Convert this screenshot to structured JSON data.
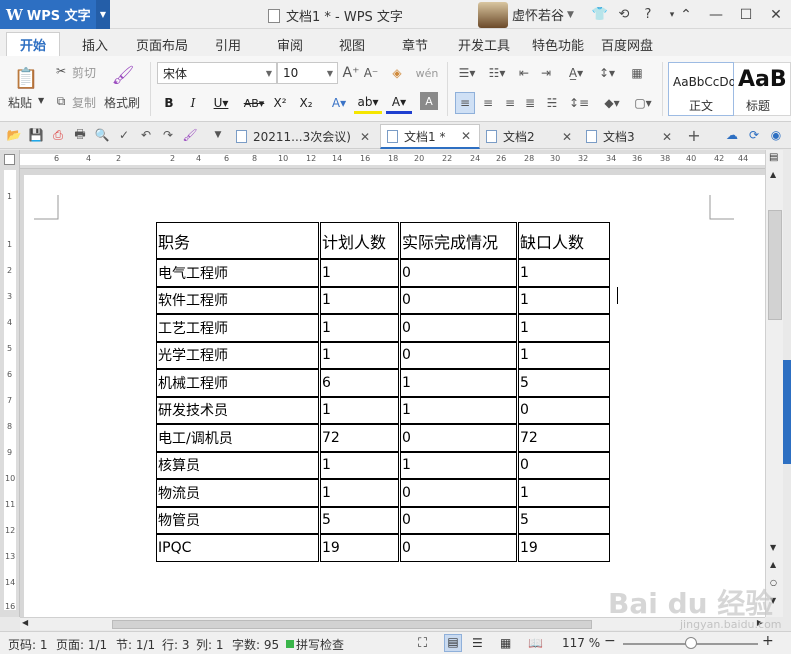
{
  "app": {
    "name": "WPS 文字",
    "window_title": "文档1 * - WPS 文字",
    "user_name": "虚怀若谷"
  },
  "menu_tabs": [
    "开始",
    "插入",
    "页面布局",
    "引用",
    "审阅",
    "视图",
    "章节",
    "开发工具",
    "特色功能",
    "百度网盘"
  ],
  "ribbon": {
    "paste": "粘贴",
    "cut": "剪切",
    "copy": "复制",
    "format_painter": "格式刷",
    "font_name": "宋体",
    "font_size": "10",
    "style_normal_preview": "AaBbCcDd",
    "style_normal_label": "正文",
    "style_heading_preview": "AaB",
    "style_heading_label": "标题"
  },
  "doc_tabs": [
    {
      "label": "20211...3次会议)"
    },
    {
      "label": "文档1 *"
    },
    {
      "label": "文档2"
    },
    {
      "label": "文档3"
    }
  ],
  "ruler": {
    "h_numbers": [
      "6",
      "4",
      "2",
      "2",
      "4",
      "6",
      "8",
      "10",
      "12",
      "14",
      "16",
      "18",
      "20",
      "22",
      "24",
      "26",
      "28",
      "30",
      "32",
      "34",
      "36",
      "38",
      "40",
      "42",
      "44",
      "46"
    ],
    "v_numbers": [
      "1",
      "2",
      "3",
      "4",
      "5",
      "6",
      "7",
      "8",
      "9",
      "10",
      "11",
      "12",
      "13",
      "14",
      "15",
      "16"
    ]
  },
  "table": {
    "headers": [
      "职务",
      "计划人数",
      "实际完成情况",
      "缺口人数"
    ],
    "rows": [
      [
        "电气工程师",
        "1",
        "0",
        "1"
      ],
      [
        "软件工程师",
        "1",
        "0",
        "1"
      ],
      [
        "工艺工程师",
        "1",
        "0",
        "1"
      ],
      [
        "光学工程师",
        "1",
        "0",
        "1"
      ],
      [
        "机械工程师",
        "6",
        "1",
        "5"
      ],
      [
        "研发技术员",
        "1",
        "1",
        "0"
      ],
      [
        "电工/调机员",
        "72",
        "0",
        "72"
      ],
      [
        "核算员",
        "1",
        "1",
        "0"
      ],
      [
        "物流员",
        "1",
        "0",
        "1"
      ],
      [
        "物管员",
        "5",
        "0",
        "5"
      ],
      [
        "IPQC",
        "19",
        "0",
        "19"
      ]
    ]
  },
  "status": {
    "page": "页码: 1",
    "pages": "页面: 1/1",
    "section": "节: 1/1",
    "line": "行: 3",
    "column": "列: 1",
    "word_count": "字数: 95",
    "spell_check": "拼写检查",
    "zoom": "117 %"
  },
  "watermark": {
    "text": "Bai du 经验",
    "url": "jingyan.baidu.com"
  },
  "colors": {
    "accent": "#2d6fc2"
  }
}
